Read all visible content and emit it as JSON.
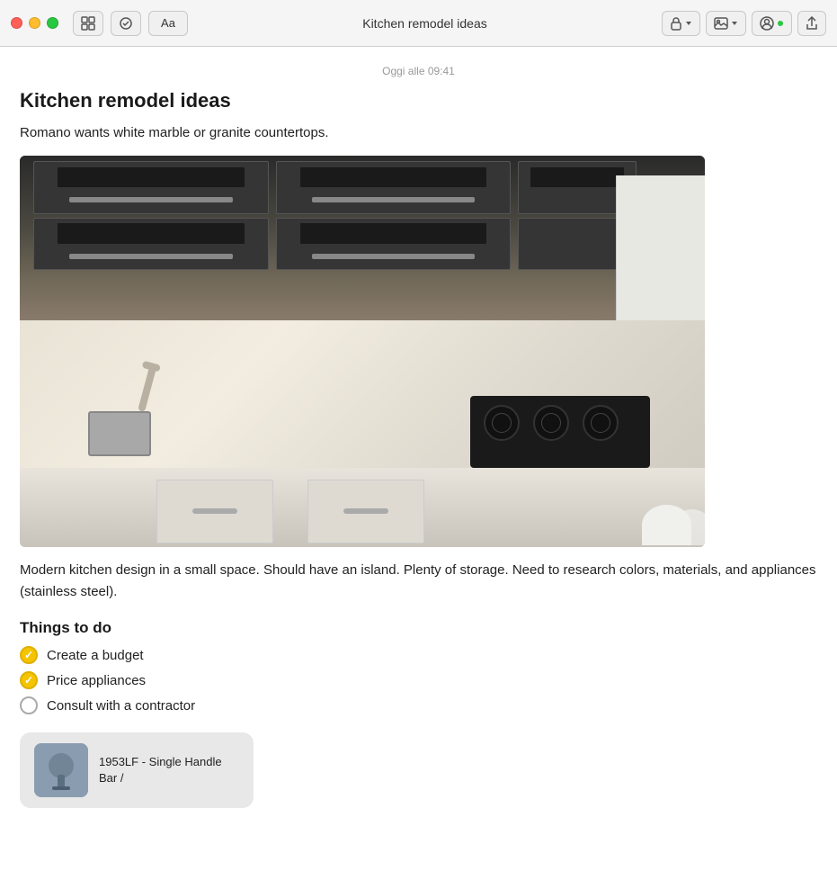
{
  "window": {
    "title": "Kitchen remodel ideas",
    "timestamp": "Oggi alle 09:41"
  },
  "toolbar": {
    "font_btn_label": "Aa",
    "lock_btn_label": "🔒",
    "gallery_btn_label": "🖼",
    "collab_btn_label": "👤",
    "share_btn_label": "↑"
  },
  "note": {
    "title": "Kitchen remodel ideas",
    "subtitle": "Romano wants white marble or granite countertops.",
    "body": "Modern kitchen design in a small space. Should have an island. Plenty of storage. Need to research colors, materials, and appliances (stainless steel).",
    "section_heading": "Things to do",
    "checklist": [
      {
        "id": 1,
        "text": "Create a budget",
        "checked": true
      },
      {
        "id": 2,
        "text": "Price appliances",
        "checked": true
      },
      {
        "id": 3,
        "text": "Consult with a contractor",
        "checked": false
      }
    ],
    "bottom_card_title": "1953LF - Single Handle Bar /"
  },
  "colors": {
    "close": "#ff5f57",
    "minimize": "#febc2e",
    "maximize": "#28c840",
    "checked_circle": "#f5c400",
    "unchecked_border": "#aaa"
  }
}
